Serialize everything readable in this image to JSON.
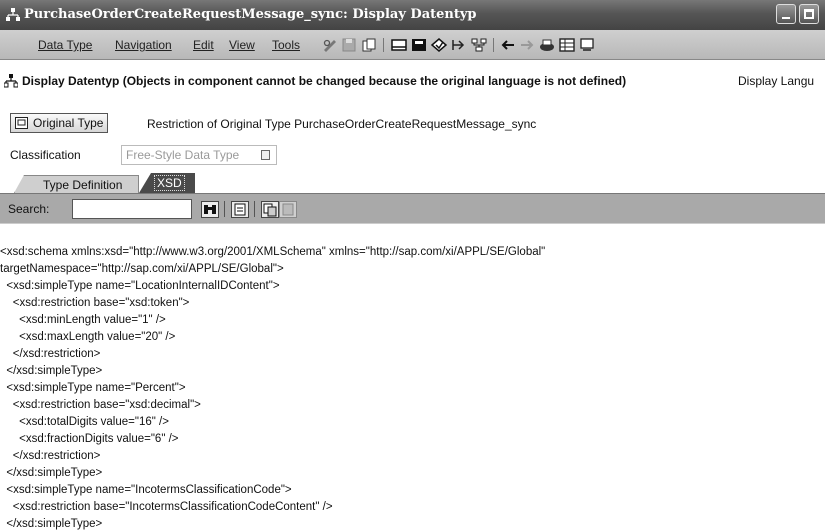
{
  "window": {
    "title": "PurchaseOrderCreateRequestMessage_sync: Display Datentyp"
  },
  "menu": {
    "items": [
      "Data Type",
      "Navigation",
      "Edit",
      "View",
      "Tools"
    ]
  },
  "toolbar_icons": [
    "pencil-glasses-icon",
    "save-icon",
    "copy-icon",
    "where-used-icon",
    "object-icon",
    "check-icon",
    "navigate-icon",
    "hierarchy-icon",
    "back-icon",
    "forward-icon",
    "print-icon",
    "display-icon",
    "info-icon"
  ],
  "header": {
    "title": "Display Datentyp (Objects in component cannot be changed because the original language is not defined)",
    "right_text": "Display Langu"
  },
  "original_type": {
    "button_label": "Original Type",
    "restriction_text": "Restriction of Original Type PurchaseOrderCreateRequestMessage_sync"
  },
  "classification": {
    "label": "Classification",
    "value": "Free-Style Data Type"
  },
  "tabs": {
    "type_definition": "Type Definition",
    "xsd": "XSD"
  },
  "search": {
    "label": "Search:",
    "value": ""
  },
  "xml_lines": [
    "<xsd:schema xmlns:xsd=\"http://www.w3.org/2001/XMLSchema\" xmlns=\"http://sap.com/xi/APPL/SE/Global\"",
    "targetNamespace=\"http://sap.com/xi/APPL/SE/Global\">",
    "  <xsd:simpleType name=\"LocationInternalIDContent\">",
    "    <xsd:restriction base=\"xsd:token\">",
    "      <xsd:minLength value=\"1\" />",
    "      <xsd:maxLength value=\"20\" />",
    "    </xsd:restriction>",
    "  </xsd:simpleType>",
    "  <xsd:simpleType name=\"Percent\">",
    "    <xsd:restriction base=\"xsd:decimal\">",
    "      <xsd:totalDigits value=\"16\" />",
    "      <xsd:fractionDigits value=\"6\" />",
    "    </xsd:restriction>",
    "  </xsd:simpleType>",
    "  <xsd:simpleType name=\"IncotermsClassificationCode\">",
    "    <xsd:restriction base=\"IncotermsClassificationCodeContent\" />",
    "  </xsd:simpleType>"
  ]
}
